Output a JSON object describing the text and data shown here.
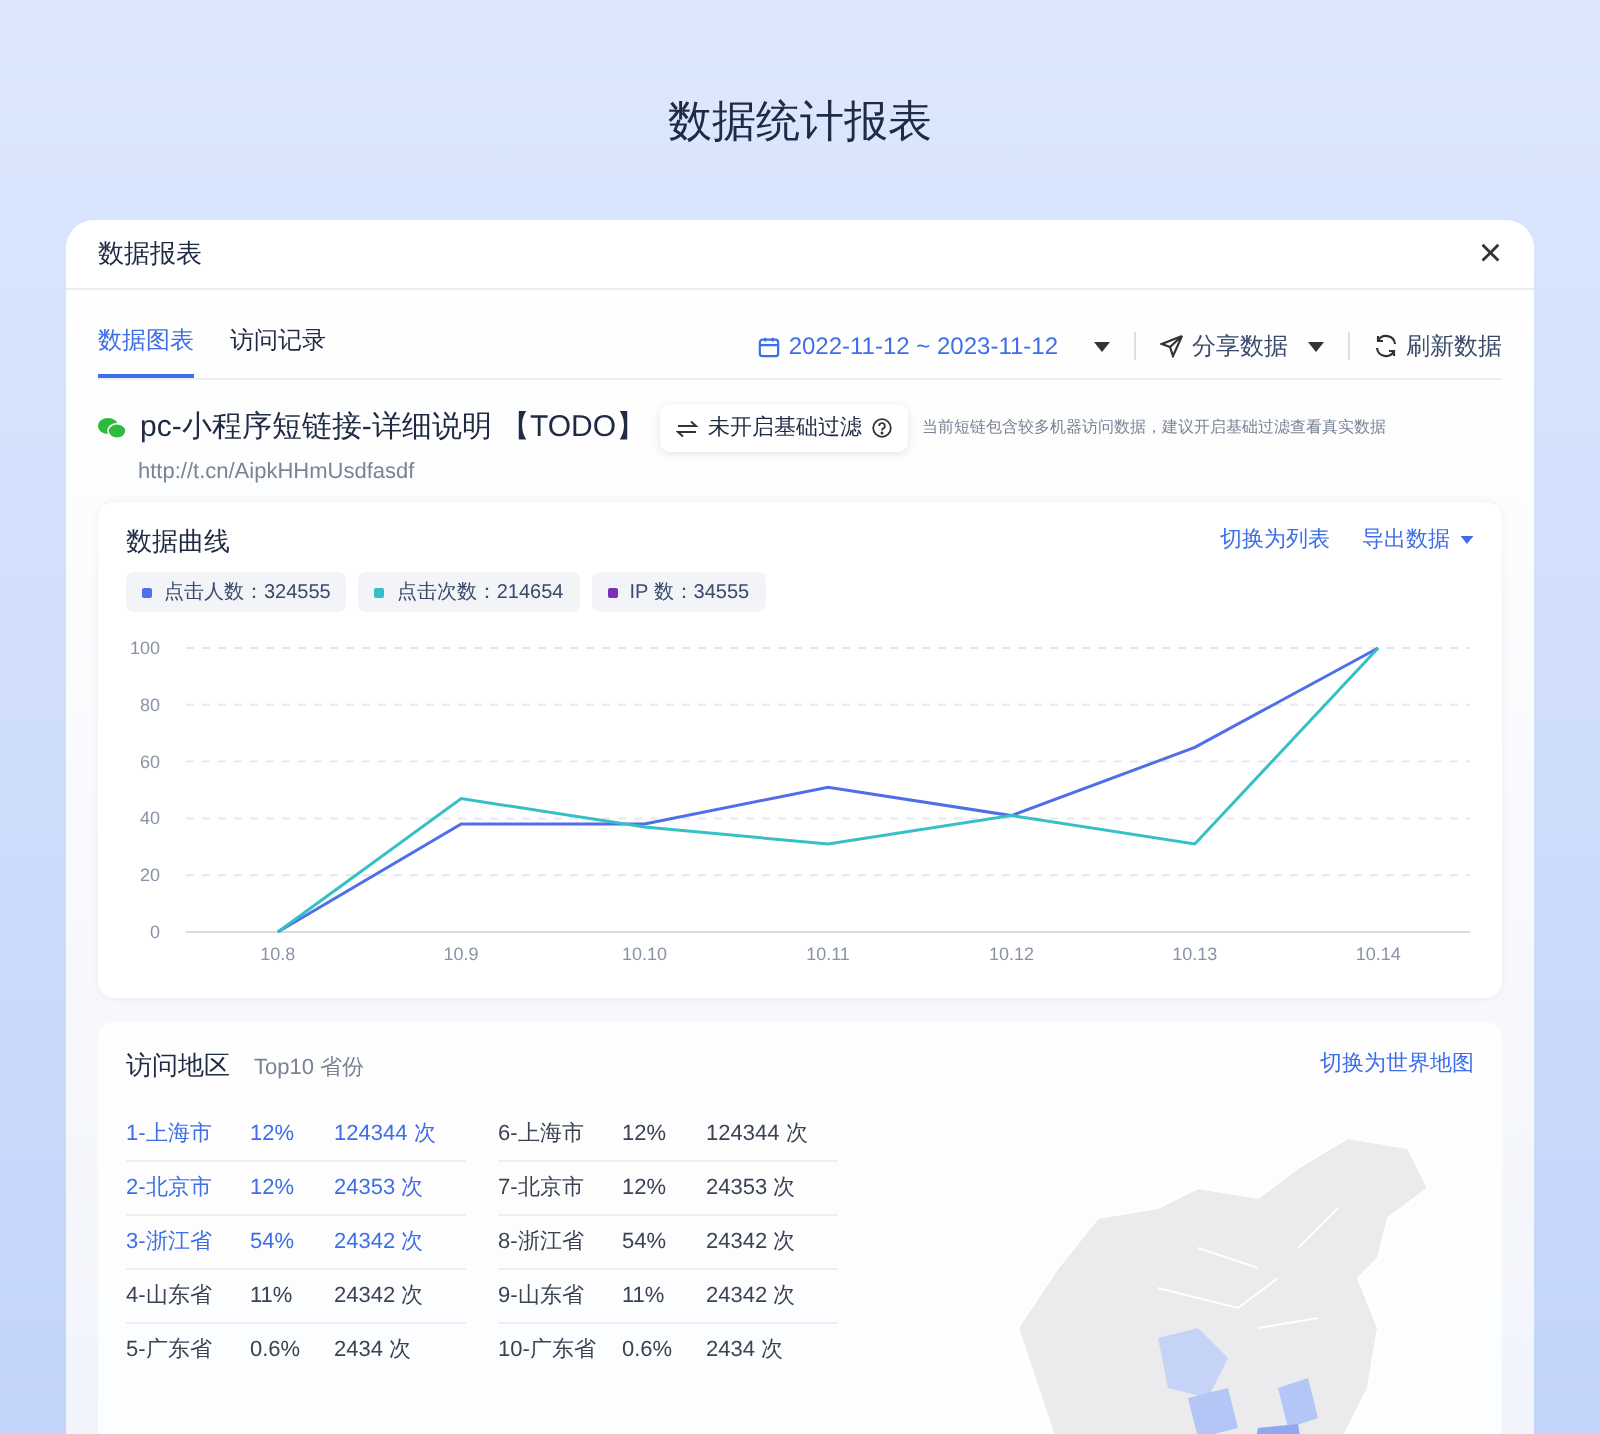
{
  "page_title": "数据统计报表",
  "dialog": {
    "title": "数据报表",
    "close": "×"
  },
  "tabs": [
    {
      "label": "数据图表",
      "selected": true
    },
    {
      "label": "访问记录",
      "selected": false
    }
  ],
  "toolbar": {
    "date_range": "2022-11-12 ~ 2023-11-12",
    "share": "分享数据",
    "refresh": "刷新数据"
  },
  "link": {
    "title": "pc-小程序短链接-详细说明 【TODO】",
    "url": "http://t.cn/AipkHHmUsdfasdf",
    "filter_button": "未开启基础过滤",
    "filter_hint": "当前短链包含较多机器访问数据，建议开启基础过滤查看真实数据"
  },
  "chart_card": {
    "title": "数据曲线",
    "switch_link": "切换为列表",
    "export_link": "导出数据",
    "legend": [
      {
        "label": "点击人数：324555",
        "color": "#4f6fe8"
      },
      {
        "label": "点击次数：214654",
        "color": "#36c0c6"
      },
      {
        "label": "IP 数：34555",
        "color": "#7b2fb8"
      }
    ],
    "chart_data": {
      "type": "line",
      "categories": [
        "10.8",
        "10.9",
        "10.10",
        "10.11",
        "10.12",
        "10.13",
        "10.14"
      ],
      "ylim": [
        0,
        100
      ],
      "grid": true,
      "yticks": [
        0,
        20,
        40,
        60,
        80,
        100
      ],
      "series": [
        {
          "color": "#4f6fe8",
          "values": [
            0,
            38,
            38,
            51,
            41,
            65,
            100
          ]
        },
        {
          "color": "#36c0c6",
          "values": [
            0,
            47,
            37,
            31,
            41,
            31,
            100
          ]
        }
      ]
    }
  },
  "region_card": {
    "title": "访问地区",
    "subtitle": "Top10 省份",
    "switch_link": "切换为世界地图",
    "columns": [
      [
        {
          "name": "1-上海市",
          "share": "12%",
          "count": "124344 次",
          "highlighted": true
        },
        {
          "name": "2-北京市",
          "share": "12%",
          "count": "24353 次",
          "highlighted": true
        },
        {
          "name": "3-浙江省",
          "share": "54%",
          "count": "24342 次",
          "highlighted": true
        },
        {
          "name": "4-山东省",
          "share": "11%",
          "count": "24342 次",
          "highlighted": false
        },
        {
          "name": "5-广东省",
          "share": "0.6%",
          "count": "2434 次",
          "highlighted": false
        }
      ],
      [
        {
          "name": "6-上海市",
          "share": "12%",
          "count": "124344 次",
          "highlighted": false
        },
        {
          "name": "7-北京市",
          "share": "12%",
          "count": "24353 次",
          "highlighted": false
        },
        {
          "name": "8-浙江省",
          "share": "54%",
          "count": "24342 次",
          "highlighted": false
        },
        {
          "name": "9-山东省",
          "share": "11%",
          "count": "24342 次",
          "highlighted": false
        },
        {
          "name": "10-广东省",
          "share": "0.6%",
          "count": "2434 次",
          "highlighted": false
        }
      ]
    ]
  }
}
